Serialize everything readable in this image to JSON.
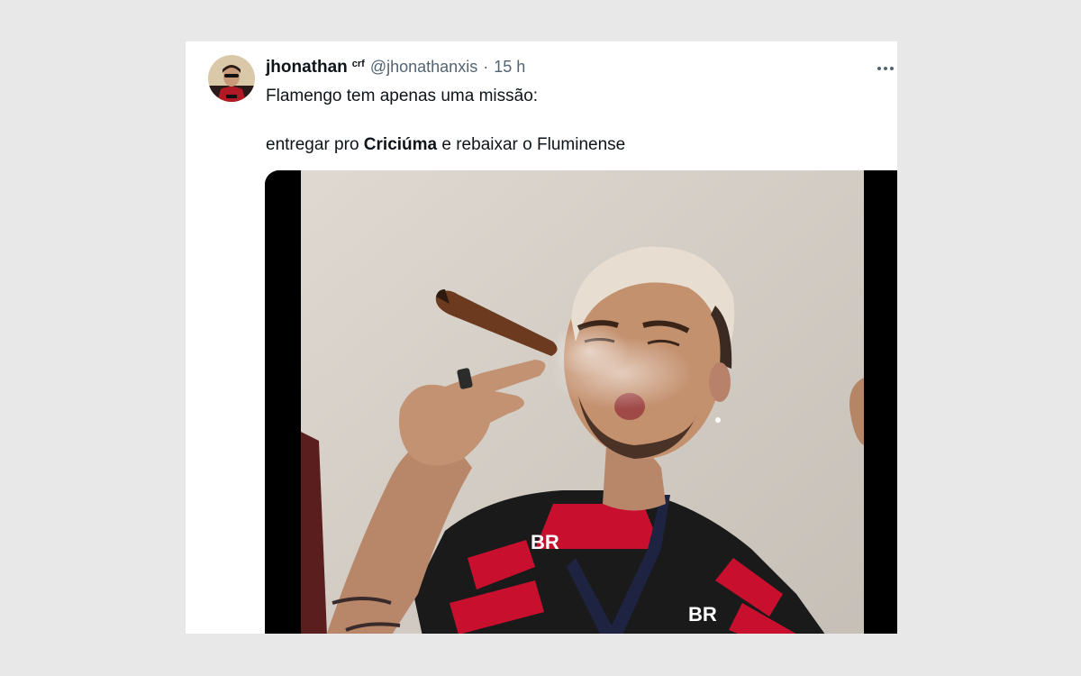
{
  "tweet": {
    "display_name": "jhonathan",
    "name_badge": "crf",
    "handle": "@jhonathanxis",
    "separator": "·",
    "time": "15 h",
    "text_line1": "Flamengo tem apenas uma missão:",
    "text_line2_before": "entregar pro ",
    "text_line2_bold": "Criciúma",
    "text_line2_after": " e rebaixar o Fluminense",
    "more_icon": "more-horizontal-icon",
    "media_type": "video"
  },
  "colors": {
    "page_bg": "#e8e8e8",
    "card_bg": "#ffffff",
    "text_primary": "#0f1419",
    "text_secondary": "#536471",
    "jersey_red": "#c8102e",
    "jersey_black": "#1a1a1a"
  }
}
